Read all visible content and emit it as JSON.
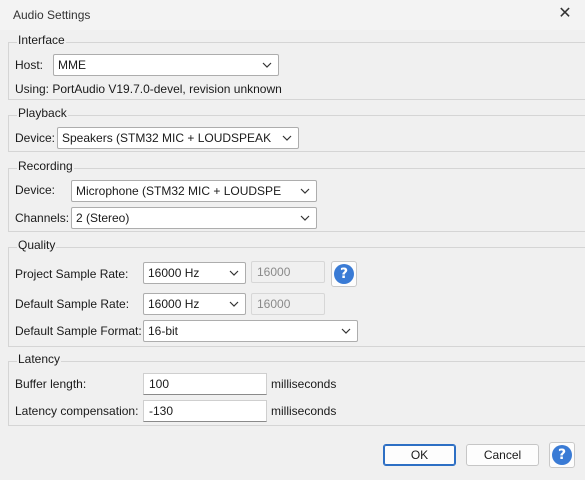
{
  "window": {
    "title": "Audio Settings",
    "close_glyph": "✕"
  },
  "interface": {
    "legend": "Interface",
    "host_label": "Host:",
    "host_value": "MME",
    "using_text": "Using: PortAudio V19.7.0-devel, revision unknown"
  },
  "playback": {
    "legend": "Playback",
    "device_label": "Device:",
    "device_value": "Speakers (STM32 MIC + LOUDSPEAK"
  },
  "recording": {
    "legend": "Recording",
    "device_label": "Device:",
    "device_value": "Microphone (STM32 MIC + LOUDSPE",
    "channels_label": "Channels:",
    "channels_value": "2 (Stereo)"
  },
  "quality": {
    "legend": "Quality",
    "project_rate_label": "Project Sample Rate:",
    "project_rate_value": "16000 Hz",
    "project_rate_custom": "16000",
    "default_rate_label": "Default Sample Rate:",
    "default_rate_value": "16000 Hz",
    "default_rate_custom": "16000",
    "default_format_label": "Default Sample Format:",
    "default_format_value": "16-bit",
    "help_glyph": "?"
  },
  "latency": {
    "legend": "Latency",
    "buffer_label": "Buffer length:",
    "buffer_value": "100",
    "buffer_unit": "milliseconds",
    "compensation_label": "Latency compensation:",
    "compensation_value": "-130",
    "compensation_unit": "milliseconds"
  },
  "footer": {
    "ok_label": "OK",
    "cancel_label": "Cancel",
    "help_glyph": "?"
  },
  "colors": {
    "background": "#f0f0f0",
    "help_icon": "#3a7bd5",
    "focus_border": "#2d6fc4"
  }
}
